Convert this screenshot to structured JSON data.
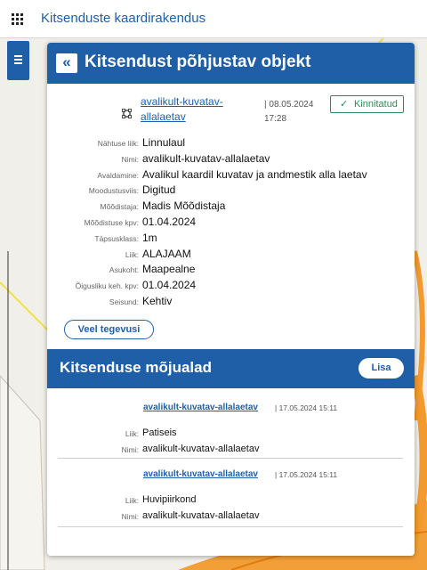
{
  "app": {
    "title": "Kitsenduste kaardirakendus"
  },
  "panel": {
    "title": "Kitsendust põhjustav objekt",
    "object": {
      "link": "avalikult-kuvatav-allalaetav",
      "date": "| 08.05.2024 17:28",
      "badge": "Kinnitatud"
    },
    "properties": [
      {
        "label": "Nähtuse liik:",
        "value": "Linnulaul"
      },
      {
        "label": "Nimi:",
        "value": "avalikult-kuvatav-allalaetav"
      },
      {
        "label": "Avaldamine:",
        "value": "Avalikul kaardil kuvatav ja andmestik alla laetav"
      },
      {
        "label": "Moodustusviis:",
        "value": "Digitud"
      },
      {
        "label": "Mõõdistaja:",
        "value": "Madis Mõõdistaja"
      },
      {
        "label": "Mõõdistuse kpv:",
        "value": "01.04.2024"
      },
      {
        "label": "Täpsusklass:",
        "value": "1m"
      },
      {
        "label": "Liik:",
        "value": "ALAJAAM"
      },
      {
        "label": "Asukoht:",
        "value": "Maapealne"
      },
      {
        "label": "Õigusliku keh. kpv:",
        "value": "01.04.2024"
      },
      {
        "label": "Seisund:",
        "value": "Kehtiv"
      }
    ],
    "more_button": "Veel tegevusi"
  },
  "zones_section": {
    "title": "Kitsenduse mõjualad",
    "add_button": "Lisa",
    "items": [
      {
        "link": "avalikult-kuvatav-allalaetav",
        "time": "| 17.05.2024 15:11",
        "type_label": "Liik:",
        "type_value": "Patiseis",
        "name_label": "Nimi:",
        "name_value": "avalikult-kuvatav-allalaetav"
      },
      {
        "link": "avalikult-kuvatav-allalaetav",
        "time": "| 17.05.2024 15:11",
        "type_label": "Liik:",
        "type_value": "Huvipiirkond",
        "name_label": "Nimi:",
        "name_value": "avalikult-kuvatav-allalaetav"
      }
    ]
  },
  "colors": {
    "primary": "#1f5fa8",
    "confirmed": "#2e8b57",
    "map_orange": "#f29a2e",
    "map_yellow": "#f2e24a"
  },
  "icons": {
    "apps": "apps-grid-icon",
    "layers": "layers-icon",
    "collapse": "double-chevron-left-icon",
    "object": "object-square-icon",
    "check": "check-icon"
  }
}
